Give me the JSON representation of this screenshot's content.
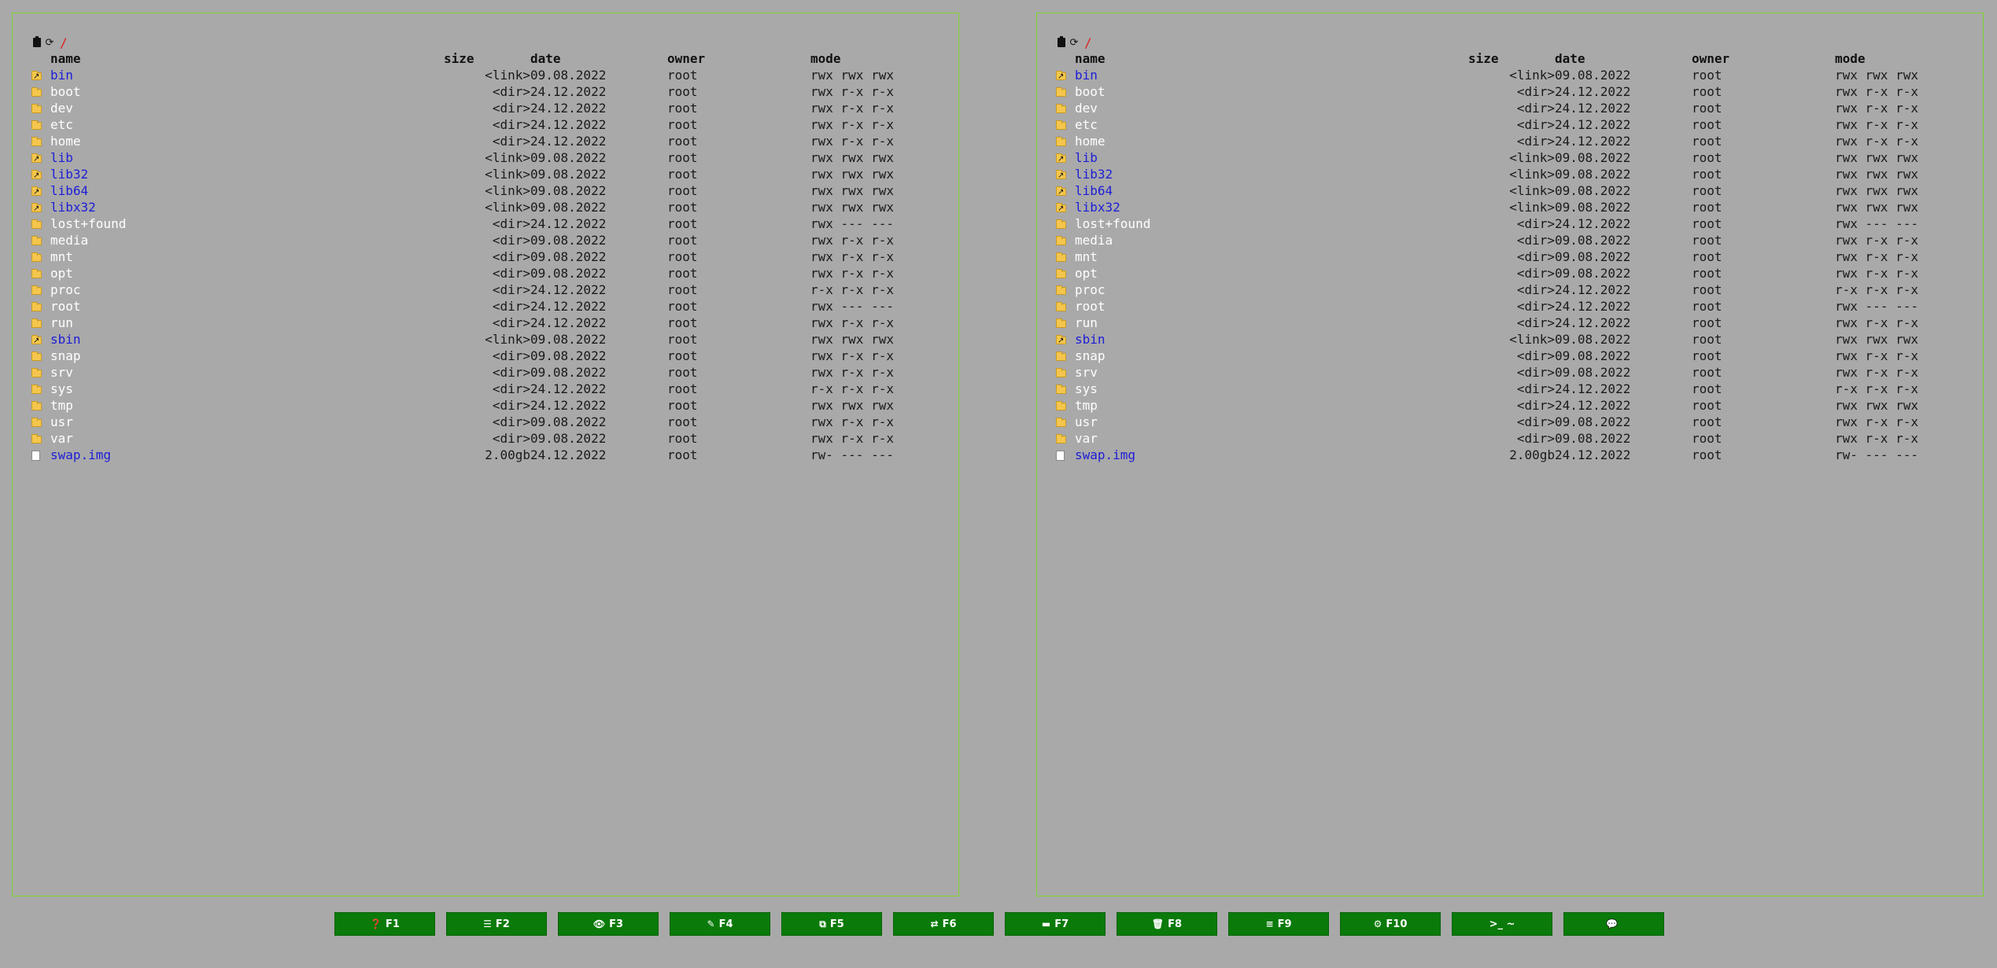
{
  "left_panel": {
    "path": "/",
    "headers": {
      "name": "name",
      "size": "size",
      "date": "date",
      "owner": "owner",
      "mode": "mode"
    },
    "rows": [
      {
        "name": "bin",
        "type": "link",
        "size": "<link>",
        "date": "09.08.2022",
        "owner": "root",
        "mode": "rwx rwx rwx"
      },
      {
        "name": "boot",
        "type": "dir",
        "size": "<dir>",
        "date": "24.12.2022",
        "owner": "root",
        "mode": "rwx r-x r-x"
      },
      {
        "name": "dev",
        "type": "dir",
        "size": "<dir>",
        "date": "24.12.2022",
        "owner": "root",
        "mode": "rwx r-x r-x"
      },
      {
        "name": "etc",
        "type": "dir",
        "size": "<dir>",
        "date": "24.12.2022",
        "owner": "root",
        "mode": "rwx r-x r-x"
      },
      {
        "name": "home",
        "type": "dir",
        "size": "<dir>",
        "date": "24.12.2022",
        "owner": "root",
        "mode": "rwx r-x r-x"
      },
      {
        "name": "lib",
        "type": "link",
        "size": "<link>",
        "date": "09.08.2022",
        "owner": "root",
        "mode": "rwx rwx rwx"
      },
      {
        "name": "lib32",
        "type": "link",
        "size": "<link>",
        "date": "09.08.2022",
        "owner": "root",
        "mode": "rwx rwx rwx"
      },
      {
        "name": "lib64",
        "type": "link",
        "size": "<link>",
        "date": "09.08.2022",
        "owner": "root",
        "mode": "rwx rwx rwx"
      },
      {
        "name": "libx32",
        "type": "link",
        "size": "<link>",
        "date": "09.08.2022",
        "owner": "root",
        "mode": "rwx rwx rwx"
      },
      {
        "name": "lost+found",
        "type": "dir",
        "size": "<dir>",
        "date": "24.12.2022",
        "owner": "root",
        "mode": "rwx --- ---"
      },
      {
        "name": "media",
        "type": "dir",
        "size": "<dir>",
        "date": "09.08.2022",
        "owner": "root",
        "mode": "rwx r-x r-x"
      },
      {
        "name": "mnt",
        "type": "dir",
        "size": "<dir>",
        "date": "09.08.2022",
        "owner": "root",
        "mode": "rwx r-x r-x"
      },
      {
        "name": "opt",
        "type": "dir",
        "size": "<dir>",
        "date": "09.08.2022",
        "owner": "root",
        "mode": "rwx r-x r-x"
      },
      {
        "name": "proc",
        "type": "dir",
        "size": "<dir>",
        "date": "24.12.2022",
        "owner": "root",
        "mode": "r-x r-x r-x"
      },
      {
        "name": "root",
        "type": "dir",
        "size": "<dir>",
        "date": "24.12.2022",
        "owner": "root",
        "mode": "rwx --- ---"
      },
      {
        "name": "run",
        "type": "dir",
        "size": "<dir>",
        "date": "24.12.2022",
        "owner": "root",
        "mode": "rwx r-x r-x"
      },
      {
        "name": "sbin",
        "type": "link",
        "size": "<link>",
        "date": "09.08.2022",
        "owner": "root",
        "mode": "rwx rwx rwx"
      },
      {
        "name": "snap",
        "type": "dir",
        "size": "<dir>",
        "date": "09.08.2022",
        "owner": "root",
        "mode": "rwx r-x r-x"
      },
      {
        "name": "srv",
        "type": "dir",
        "size": "<dir>",
        "date": "09.08.2022",
        "owner": "root",
        "mode": "rwx r-x r-x"
      },
      {
        "name": "sys",
        "type": "dir",
        "size": "<dir>",
        "date": "24.12.2022",
        "owner": "root",
        "mode": "r-x r-x r-x"
      },
      {
        "name": "tmp",
        "type": "dir",
        "size": "<dir>",
        "date": "24.12.2022",
        "owner": "root",
        "mode": "rwx rwx rwx"
      },
      {
        "name": "usr",
        "type": "dir",
        "size": "<dir>",
        "date": "09.08.2022",
        "owner": "root",
        "mode": "rwx r-x r-x"
      },
      {
        "name": "var",
        "type": "dir",
        "size": "<dir>",
        "date": "09.08.2022",
        "owner": "root",
        "mode": "rwx r-x r-x"
      },
      {
        "name": "swap.img",
        "type": "file",
        "size": "2.00gb",
        "date": "24.12.2022",
        "owner": "root",
        "mode": "rw- --- ---"
      }
    ]
  },
  "right_panel": {
    "path": "/",
    "headers": {
      "name": "name",
      "size": "size",
      "date": "date",
      "owner": "owner",
      "mode": "mode"
    },
    "rows": [
      {
        "name": "bin",
        "type": "link",
        "size": "<link>",
        "date": "09.08.2022",
        "owner": "root",
        "mode": "rwx rwx rwx"
      },
      {
        "name": "boot",
        "type": "dir",
        "size": "<dir>",
        "date": "24.12.2022",
        "owner": "root",
        "mode": "rwx r-x r-x"
      },
      {
        "name": "dev",
        "type": "dir",
        "size": "<dir>",
        "date": "24.12.2022",
        "owner": "root",
        "mode": "rwx r-x r-x"
      },
      {
        "name": "etc",
        "type": "dir",
        "size": "<dir>",
        "date": "24.12.2022",
        "owner": "root",
        "mode": "rwx r-x r-x"
      },
      {
        "name": "home",
        "type": "dir",
        "size": "<dir>",
        "date": "24.12.2022",
        "owner": "root",
        "mode": "rwx r-x r-x"
      },
      {
        "name": "lib",
        "type": "link",
        "size": "<link>",
        "date": "09.08.2022",
        "owner": "root",
        "mode": "rwx rwx rwx"
      },
      {
        "name": "lib32",
        "type": "link",
        "size": "<link>",
        "date": "09.08.2022",
        "owner": "root",
        "mode": "rwx rwx rwx"
      },
      {
        "name": "lib64",
        "type": "link",
        "size": "<link>",
        "date": "09.08.2022",
        "owner": "root",
        "mode": "rwx rwx rwx"
      },
      {
        "name": "libx32",
        "type": "link",
        "size": "<link>",
        "date": "09.08.2022",
        "owner": "root",
        "mode": "rwx rwx rwx"
      },
      {
        "name": "lost+found",
        "type": "dir",
        "size": "<dir>",
        "date": "24.12.2022",
        "owner": "root",
        "mode": "rwx --- ---"
      },
      {
        "name": "media",
        "type": "dir",
        "size": "<dir>",
        "date": "09.08.2022",
        "owner": "root",
        "mode": "rwx r-x r-x"
      },
      {
        "name": "mnt",
        "type": "dir",
        "size": "<dir>",
        "date": "09.08.2022",
        "owner": "root",
        "mode": "rwx r-x r-x"
      },
      {
        "name": "opt",
        "type": "dir",
        "size": "<dir>",
        "date": "09.08.2022",
        "owner": "root",
        "mode": "rwx r-x r-x"
      },
      {
        "name": "proc",
        "type": "dir",
        "size": "<dir>",
        "date": "24.12.2022",
        "owner": "root",
        "mode": "r-x r-x r-x"
      },
      {
        "name": "root",
        "type": "dir",
        "size": "<dir>",
        "date": "24.12.2022",
        "owner": "root",
        "mode": "rwx --- ---"
      },
      {
        "name": "run",
        "type": "dir",
        "size": "<dir>",
        "date": "24.12.2022",
        "owner": "root",
        "mode": "rwx r-x r-x"
      },
      {
        "name": "sbin",
        "type": "link",
        "size": "<link>",
        "date": "09.08.2022",
        "owner": "root",
        "mode": "rwx rwx rwx"
      },
      {
        "name": "snap",
        "type": "dir",
        "size": "<dir>",
        "date": "09.08.2022",
        "owner": "root",
        "mode": "rwx r-x r-x"
      },
      {
        "name": "srv",
        "type": "dir",
        "size": "<dir>",
        "date": "09.08.2022",
        "owner": "root",
        "mode": "rwx r-x r-x"
      },
      {
        "name": "sys",
        "type": "dir",
        "size": "<dir>",
        "date": "24.12.2022",
        "owner": "root",
        "mode": "r-x r-x r-x"
      },
      {
        "name": "tmp",
        "type": "dir",
        "size": "<dir>",
        "date": "24.12.2022",
        "owner": "root",
        "mode": "rwx rwx rwx"
      },
      {
        "name": "usr",
        "type": "dir",
        "size": "<dir>",
        "date": "09.08.2022",
        "owner": "root",
        "mode": "rwx r-x r-x"
      },
      {
        "name": "var",
        "type": "dir",
        "size": "<dir>",
        "date": "09.08.2022",
        "owner": "root",
        "mode": "rwx r-x r-x"
      },
      {
        "name": "swap.img",
        "type": "file",
        "size": "2.00gb",
        "date": "24.12.2022",
        "owner": "root",
        "mode": "rw- --- ---"
      }
    ]
  },
  "function_keys": [
    {
      "label": "F1",
      "icon": "help-icon",
      "glyph": "❓"
    },
    {
      "label": "F2",
      "icon": "list-icon",
      "glyph": "☰"
    },
    {
      "label": "F3",
      "icon": "eye-icon",
      "glyph": "👁"
    },
    {
      "label": "F4",
      "icon": "edit-icon",
      "glyph": "✎"
    },
    {
      "label": "F5",
      "icon": "copy-icon",
      "glyph": "⧉"
    },
    {
      "label": "F6",
      "icon": "move-icon",
      "glyph": "⇄"
    },
    {
      "label": "F7",
      "icon": "folder-icon",
      "glyph": "▬"
    },
    {
      "label": "F8",
      "icon": "trash-icon",
      "glyph": "🗑"
    },
    {
      "label": "F9",
      "icon": "menu-icon",
      "glyph": "≡"
    },
    {
      "label": "F10",
      "icon": "gear-icon",
      "glyph": "⚙"
    },
    {
      "label": ">_ ~",
      "icon": "terminal-icon",
      "glyph": ""
    },
    {
      "label": "",
      "icon": "chat-icon",
      "glyph": "💬"
    }
  ],
  "colors": {
    "background": "#a9a9a9",
    "panel_border": "#7ed32a",
    "dir_name": "#ffffff",
    "link_name": "#1d1dd8",
    "path": "#e0201f",
    "function_key": "#0a7a0a"
  }
}
